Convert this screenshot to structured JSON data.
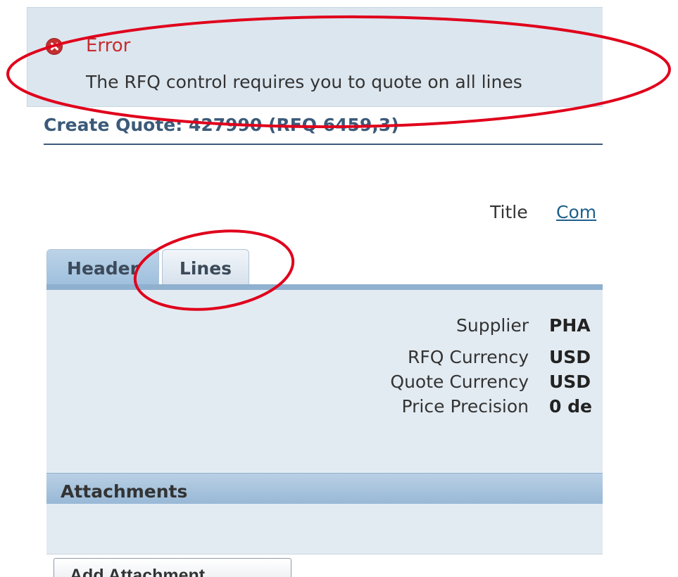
{
  "error": {
    "title": "Error",
    "message": "The RFQ control requires you to quote on all lines",
    "icon": "error-icon"
  },
  "page": {
    "heading": "Create Quote: 427990 (RFQ 6459,3)"
  },
  "title_row": {
    "label": "Title",
    "value": "Com"
  },
  "tabs": [
    {
      "label": "Header",
      "selected": true
    },
    {
      "label": "Lines",
      "selected": false
    }
  ],
  "fields": [
    {
      "label": "Supplier",
      "value": "PHA"
    },
    {
      "label": "RFQ Currency",
      "value": "USD"
    },
    {
      "label": "Quote Currency",
      "value": "USD"
    },
    {
      "label": "Price Precision",
      "value": "0 de"
    }
  ],
  "attachments": {
    "title": "Attachments",
    "add_button": "Add Attachment"
  },
  "colors": {
    "error_red": "#c42f30",
    "annotation_red": "#e0001b",
    "heading_blue": "#3c5a79",
    "link_blue": "#1f5f8b",
    "panel_bg": "#e3ebf2"
  }
}
